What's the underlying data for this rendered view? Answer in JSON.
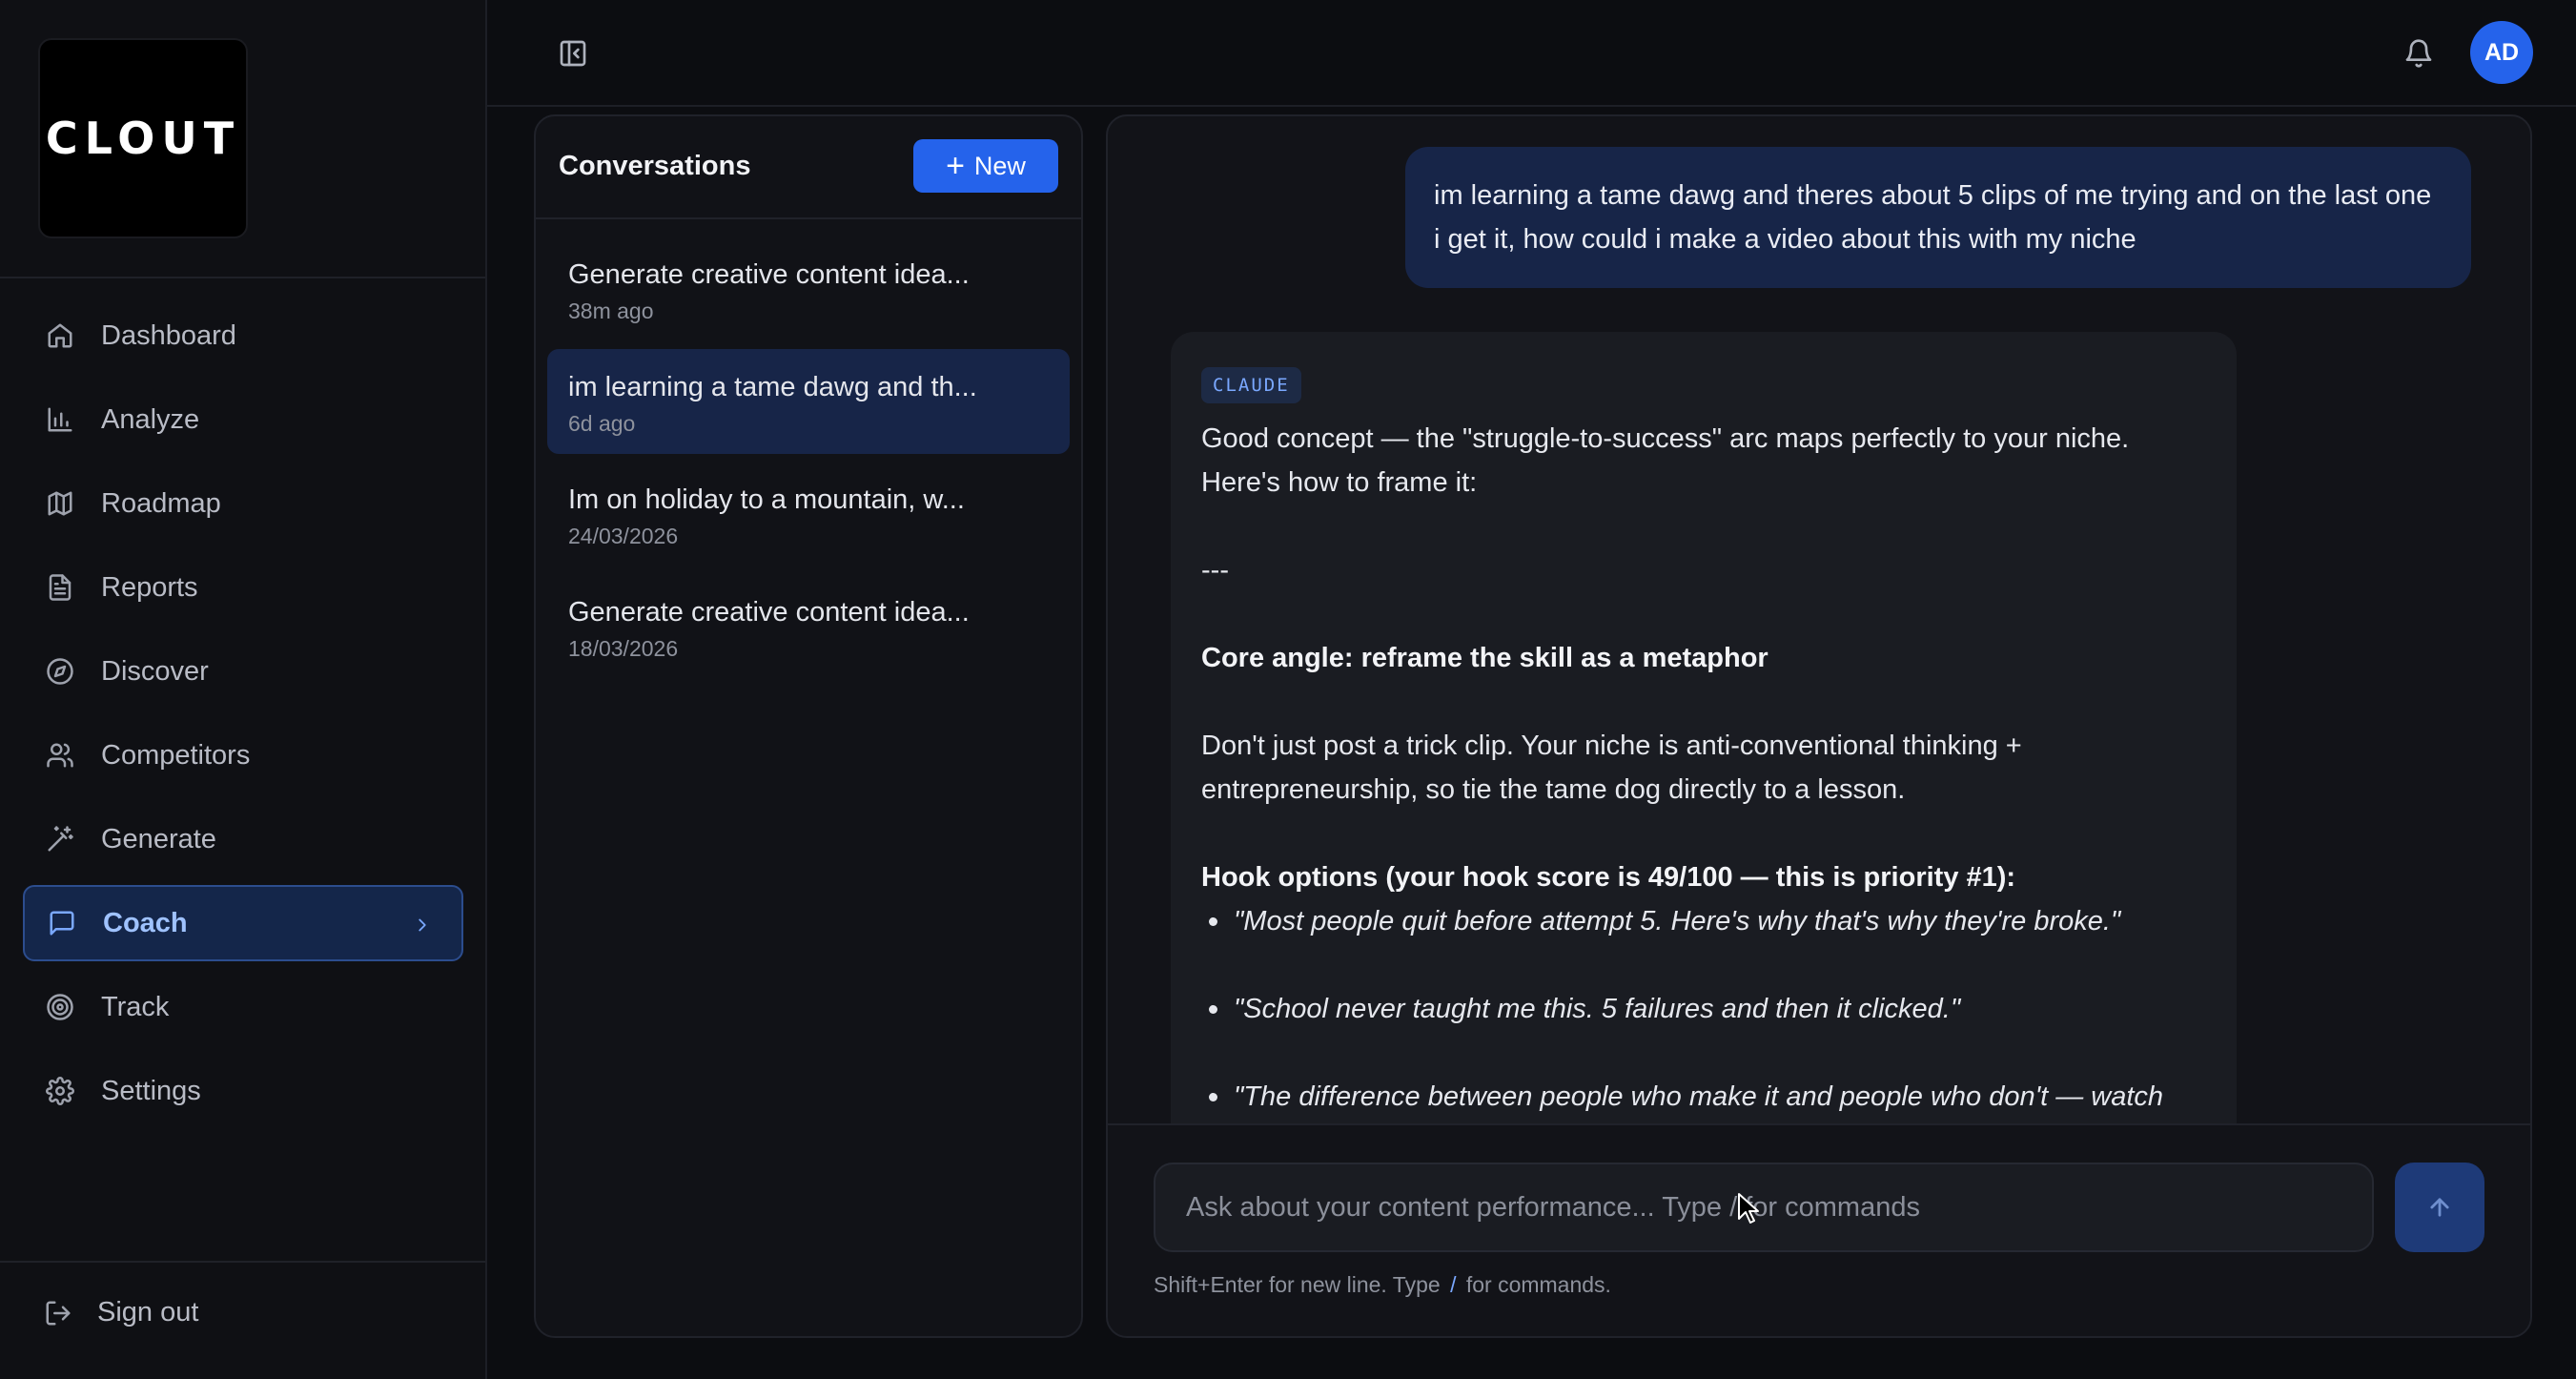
{
  "app": {
    "logo_text": "CLOUT"
  },
  "sidebar": {
    "items": [
      {
        "label": "Dashboard",
        "icon": "home-icon"
      },
      {
        "label": "Analyze",
        "icon": "bar-chart-icon"
      },
      {
        "label": "Roadmap",
        "icon": "map-icon"
      },
      {
        "label": "Reports",
        "icon": "file-text-icon"
      },
      {
        "label": "Discover",
        "icon": "compass-icon"
      },
      {
        "label": "Competitors",
        "icon": "users-icon"
      },
      {
        "label": "Generate",
        "icon": "magic-wand-icon"
      },
      {
        "label": "Coach",
        "icon": "message-square-icon",
        "active": true
      },
      {
        "label": "Track",
        "icon": "target-icon"
      },
      {
        "label": "Settings",
        "icon": "gear-icon"
      }
    ],
    "sign_out": "Sign out"
  },
  "header": {
    "avatar_initials": "AD"
  },
  "conversations": {
    "title": "Conversations",
    "new_label": "New",
    "items": [
      {
        "name": "Generate creative content idea...",
        "time": "38m ago"
      },
      {
        "name": "im learning a tame dawg and th...",
        "time": "6d ago",
        "active": true
      },
      {
        "name": "Im on holiday to a mountain, w...",
        "time": "24/03/2026"
      },
      {
        "name": "Generate creative content idea...",
        "time": "18/03/2026"
      }
    ]
  },
  "chat": {
    "user_message": "im learning a tame dawg and theres about 5 clips of me trying and on the last one i get it, how could i make a video about this with my niche",
    "assistant_badge": "CLAUDE",
    "assistant": {
      "intro": "Good concept — the \"struggle-to-success\" arc maps perfectly to your niche. Here's how to frame it:",
      "separator": "---",
      "core_angle": "Core angle: reframe the skill as a metaphor",
      "body": "Don't just post a trick clip. Your niche is anti-conventional thinking + entrepreneurship, so tie the tame dog directly to a lesson.",
      "hook_heading": "Hook options (your hook score is 49/100 — this is priority #1):",
      "hooks": [
        "\"Most people quit before attempt 5. Here's why that's why they're broke.\"",
        "\"School never taught me this. 5 failures and then it clicked.\"",
        "\"The difference between people who make it and people who don't — watch"
      ]
    },
    "input_placeholder": "Ask about your content performance... Type / for commands",
    "hint_prefix": "Shift+Enter for new line. Type",
    "hint_slash": "/",
    "hint_suffix": "for commands."
  },
  "colors": {
    "accent": "#2563eb",
    "active_bg": "#14264a",
    "background": "#0c0d11"
  }
}
